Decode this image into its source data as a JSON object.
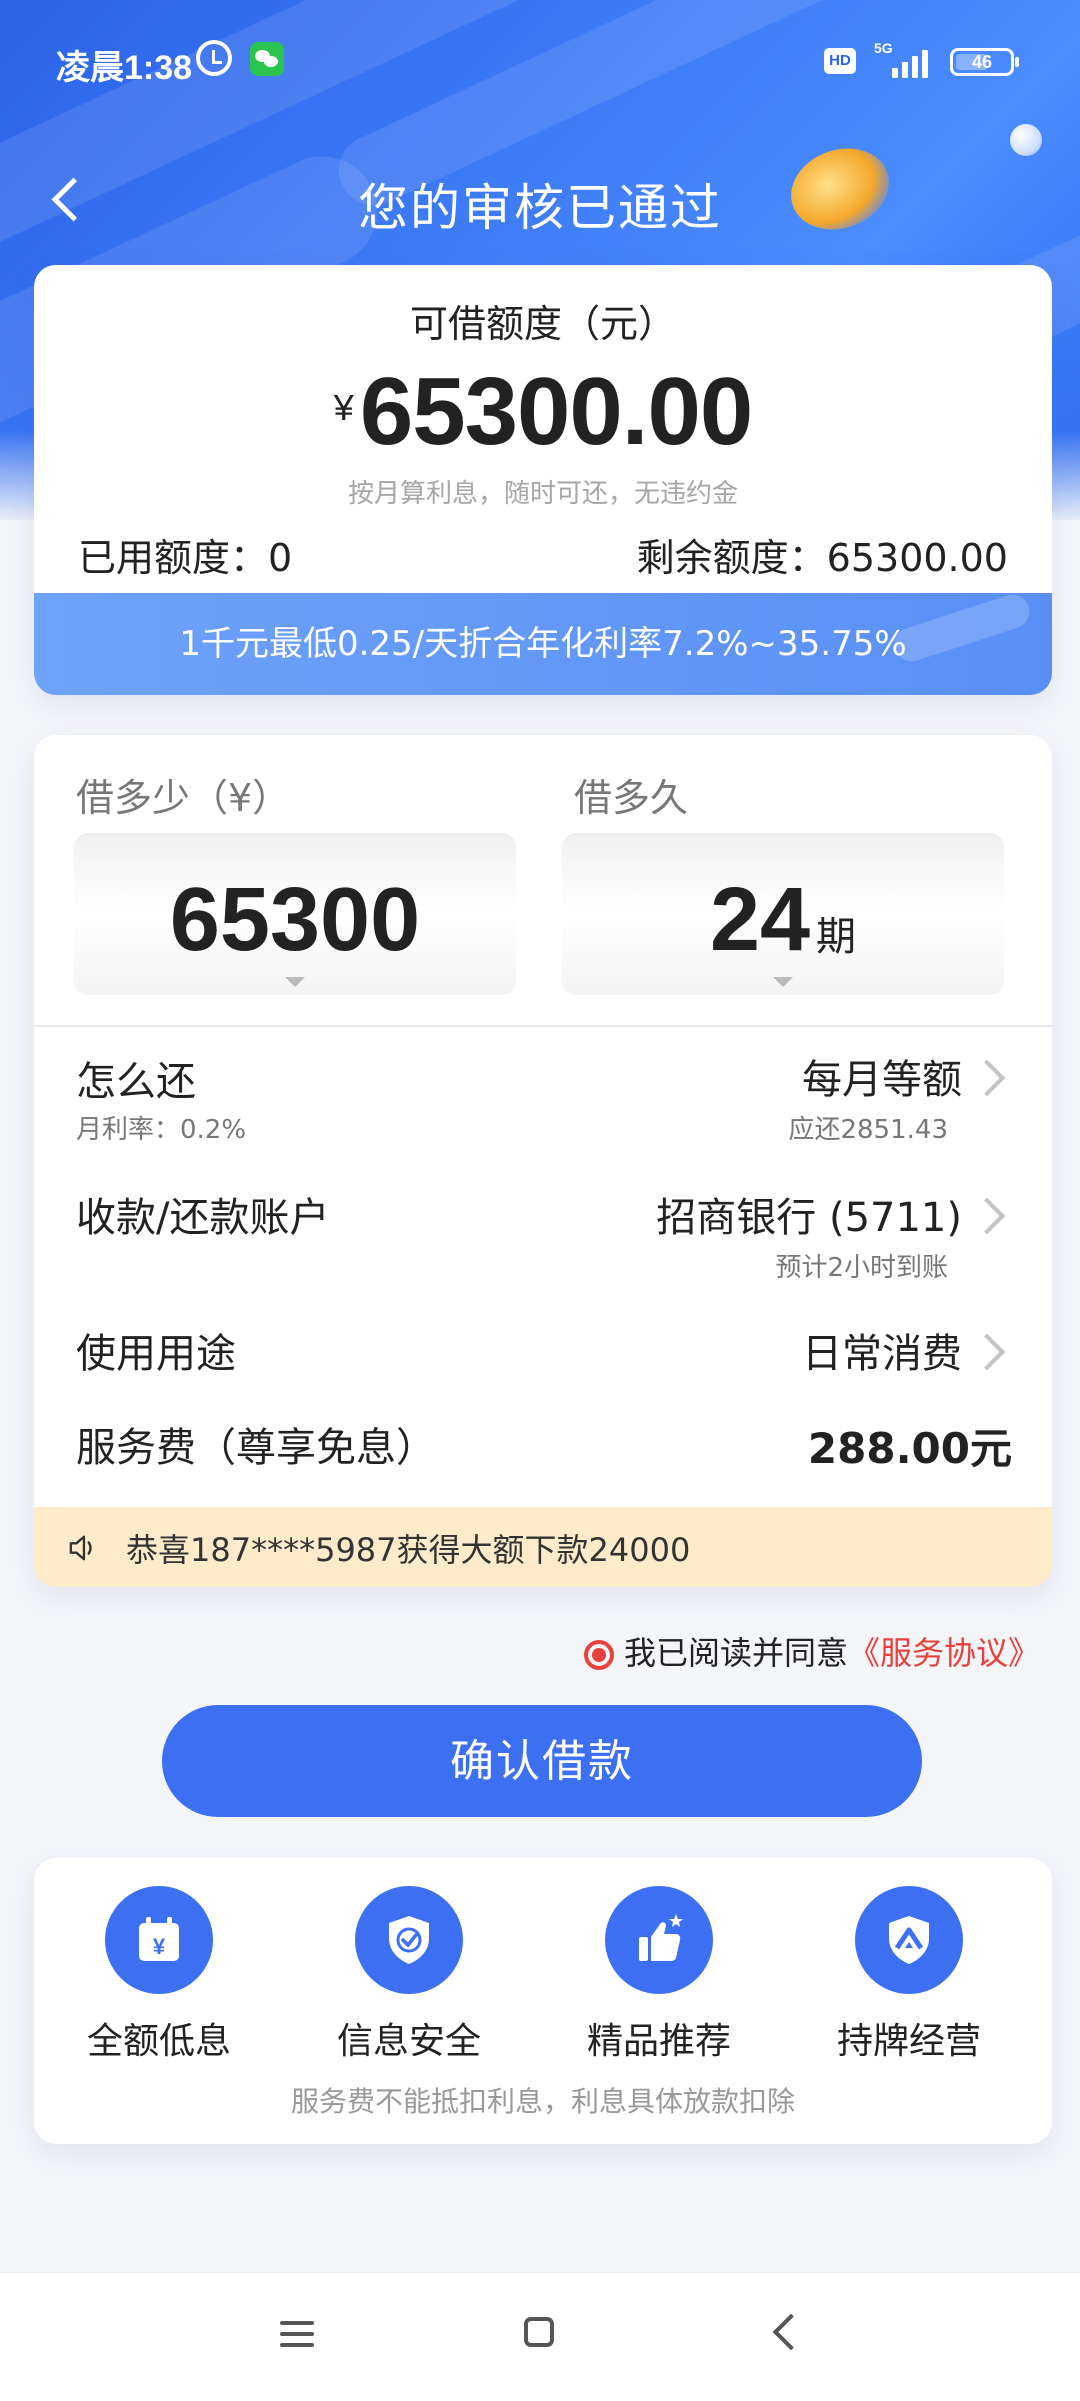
{
  "status_bar": {
    "time": "凌晨1:38",
    "hd_label": "HD",
    "network": "5G",
    "battery": "46"
  },
  "header": {
    "title": "您的审核已通过"
  },
  "quota": {
    "label": "可借额度（元）",
    "currency": "¥",
    "amount": "65300.00",
    "note": "按月算利息，随时可还，无违约金",
    "used": "已用额度：0",
    "remaining": "剩余额度：65300.00",
    "rate_banner": "1千元最低0.25/天折合年化利率7.2%~35.75%"
  },
  "loan": {
    "amount_label": "借多少（¥）",
    "term_label": "借多久",
    "amount_value": "65300",
    "term_value": "24",
    "term_unit": "期",
    "repay_title": "怎么还",
    "repay_rate": "月利率：0.2%",
    "repay_method": "每月等额",
    "repay_amount": "应还2851.43",
    "account_title": "收款/还款账户",
    "account_value": "招商银行 (5711)",
    "account_note": "预计2小时到账",
    "purpose_title": "使用用途",
    "purpose_value": "日常消费",
    "fee_title": "服务费（尊享免息）",
    "fee_value": "288.00元",
    "notice": "恭喜187****5987获得大额下款24000"
  },
  "agreement": {
    "text": "我已阅读并同意",
    "link": "《服务协议》"
  },
  "confirm_label": "确认借款",
  "features": {
    "items": [
      {
        "label": "全额低息",
        "icon": "calendar-yen-icon"
      },
      {
        "label": "信息安全",
        "icon": "shield-check-icon"
      },
      {
        "label": "精品推荐",
        "icon": "thumbs-up-icon"
      },
      {
        "label": "持牌经营",
        "icon": "license-shield-icon"
      }
    ],
    "footnote": "服务费不能抵扣利息，利息具体放款扣除"
  },
  "colors": {
    "primary": "#3d6ff2",
    "notice_bg": "#fdebc9",
    "agree_red": "#e8413c"
  }
}
